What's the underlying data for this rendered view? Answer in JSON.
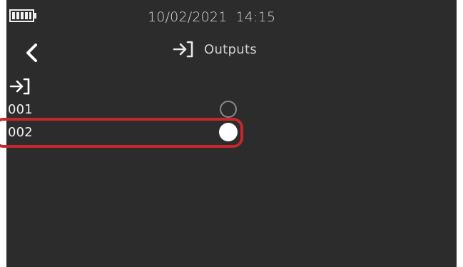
{
  "status_bar": {
    "date": "10/02/2021",
    "time": "14:15",
    "battery_icon": "battery-full-icon"
  },
  "header": {
    "back_icon": "chevron-left-icon",
    "title_icon": "output-arrow-icon",
    "title": "Outputs"
  },
  "section": {
    "icon": "output-arrow-icon"
  },
  "outputs": [
    {
      "label": "001",
      "selected": false
    },
    {
      "label": "002",
      "selected": true
    }
  ],
  "colors": {
    "background": "#2c2c2c",
    "text": "#f2f2f2",
    "highlight": "#c8262c",
    "radio_selected": "#ffffff",
    "radio_unselected": "#8a8a8a"
  }
}
